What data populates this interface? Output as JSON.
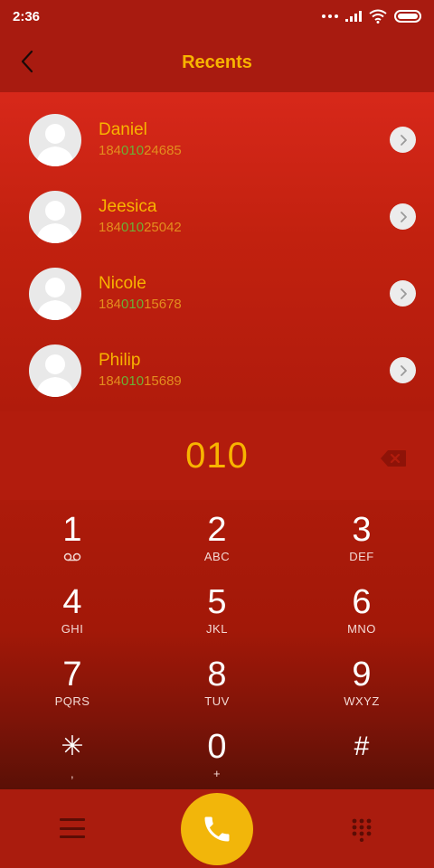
{
  "status_bar": {
    "time": "2:36"
  },
  "header": {
    "title": "Recents"
  },
  "contacts": [
    {
      "name": "Daniel",
      "number_prefix": "184",
      "number_match": "010",
      "number_suffix": "24685"
    },
    {
      "name": "Jeesica",
      "number_prefix": "184",
      "number_match": "010",
      "number_suffix": "25042"
    },
    {
      "name": "Nicole",
      "number_prefix": "184",
      "number_match": "010",
      "number_suffix": "15678"
    },
    {
      "name": "Philip",
      "number_prefix": "184",
      "number_match": "010",
      "number_suffix": "15689"
    }
  ],
  "dialer": {
    "dialed_number": "010"
  },
  "keypad": {
    "keys": [
      {
        "digit": "1",
        "letters": ""
      },
      {
        "digit": "2",
        "letters": "ABC"
      },
      {
        "digit": "3",
        "letters": "DEF"
      },
      {
        "digit": "4",
        "letters": "GHI"
      },
      {
        "digit": "5",
        "letters": "JKL"
      },
      {
        "digit": "6",
        "letters": "MNO"
      },
      {
        "digit": "7",
        "letters": "PQRS"
      },
      {
        "digit": "8",
        "letters": "TUV"
      },
      {
        "digit": "9",
        "letters": "WXYZ"
      },
      {
        "digit": "✳",
        "letters": ","
      },
      {
        "digit": "0",
        "letters": "+"
      },
      {
        "digit": "#",
        "letters": ""
      }
    ]
  },
  "icons": {
    "back": "chevron-left-icon",
    "contact_detail": "chevron-right-icon",
    "backspace": "backspace-icon",
    "voicemail": "voicemail-icon",
    "menu": "menu-icon",
    "call": "phone-icon",
    "dialpad": "dialpad-icon"
  },
  "colors": {
    "accent": "#f8b400",
    "number_highlight": "#6bb036",
    "number_text": "#e38d1e",
    "call_button": "#f2b60a"
  }
}
